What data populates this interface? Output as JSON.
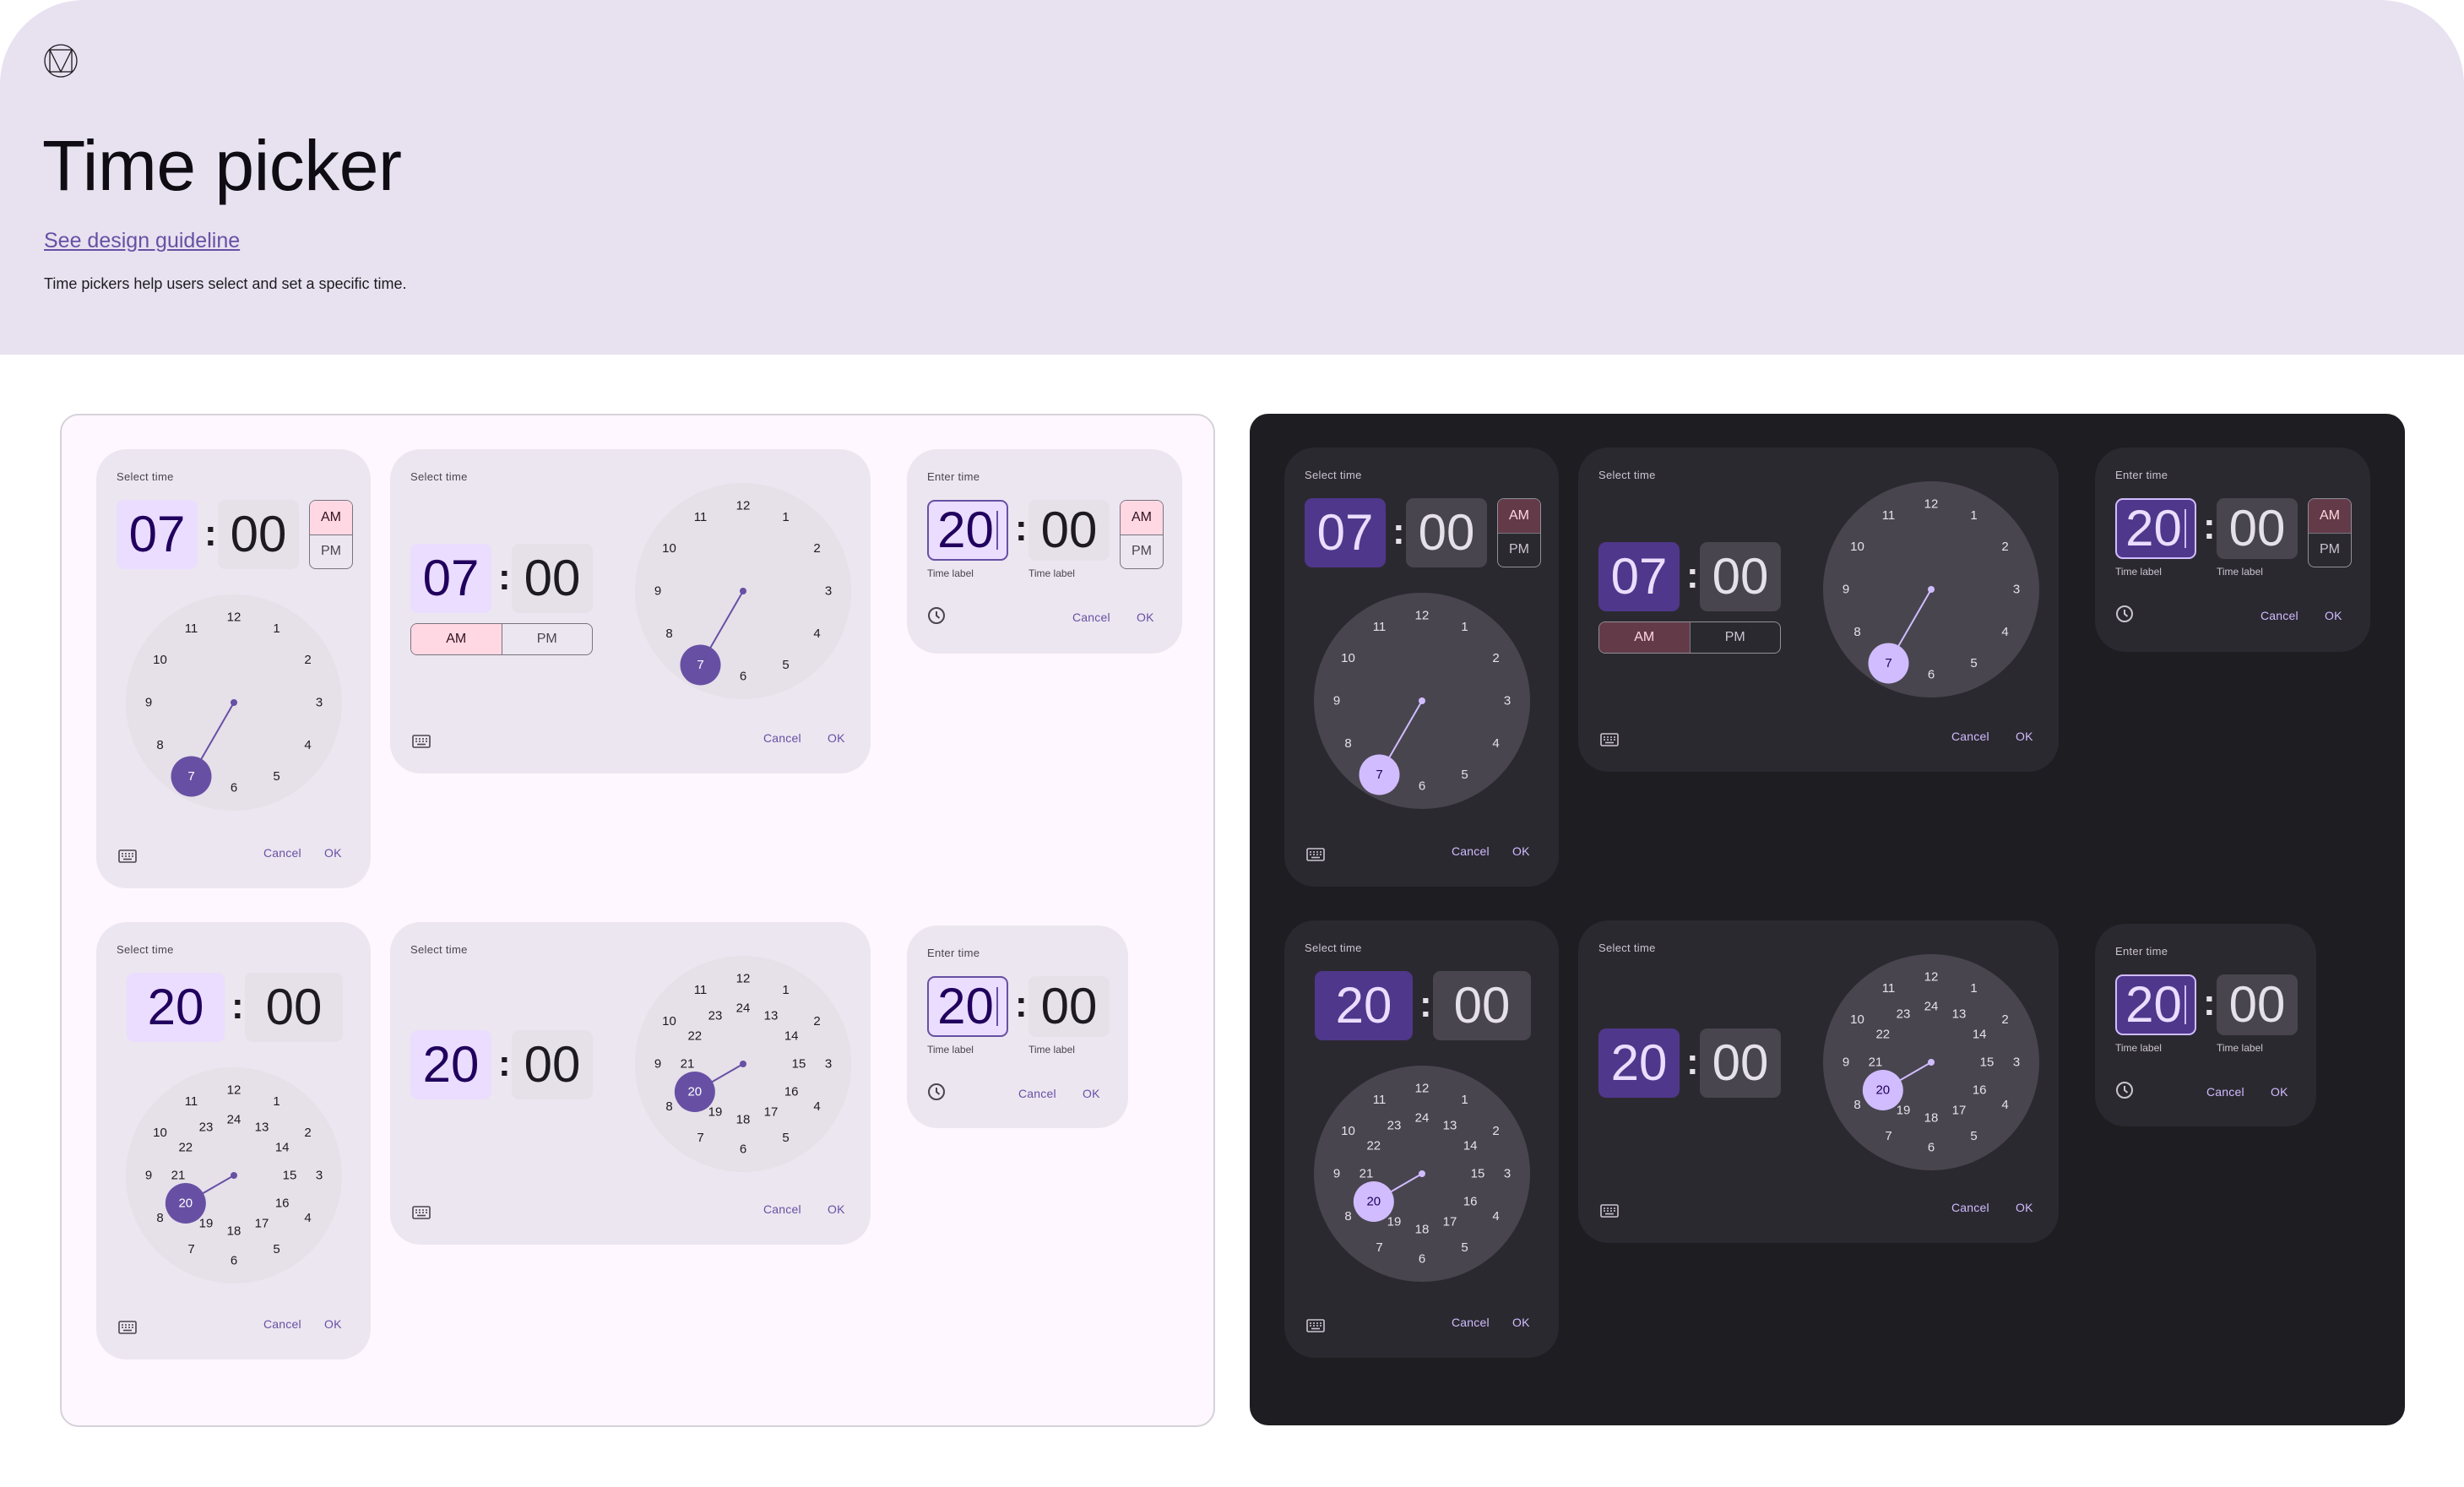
{
  "header": {
    "logo_icon": "material-logo-icon",
    "title": "Time picker",
    "link": "See design guideline",
    "description": "Time pickers help users select and set a specific time."
  },
  "colors": {
    "primary_light": "#6750A4",
    "primary_dark": "#D0BCFF",
    "header_bg": "#E8E2F0",
    "dark_panel_bg": "#1E1D21"
  },
  "labels": {
    "select_time": "Select time",
    "enter_time": "Enter time",
    "am": "AM",
    "pm": "PM",
    "cancel": "Cancel",
    "ok": "OK",
    "time_label": "Time label",
    "colon": ":"
  },
  "dial_12": [
    "12",
    "1",
    "2",
    "3",
    "4",
    "5",
    "6",
    "7",
    "8",
    "9",
    "10",
    "11"
  ],
  "dial_24_inner": [
    "24",
    "13",
    "14",
    "15",
    "16",
    "17",
    "18",
    "19",
    "20",
    "21",
    "22",
    "23"
  ],
  "themes": [
    {
      "name": "light",
      "pickers": [
        {
          "id": "dial-vertical-12h",
          "type": "dial-vertical",
          "hour": "07",
          "minute": "00",
          "period": "AM",
          "format": "12h",
          "selected_hour": 7
        },
        {
          "id": "dial-horizontal-12h",
          "type": "dial-horizontal",
          "hour": "07",
          "minute": "00",
          "period": "AM",
          "format": "12h",
          "selected_hour": 7
        },
        {
          "id": "input-12h",
          "type": "input",
          "hour": "20",
          "minute": "00",
          "period": "AM",
          "format": "12h"
        },
        {
          "id": "dial-vertical-24h",
          "type": "dial-vertical",
          "hour": "20",
          "minute": "00",
          "format": "24h",
          "selected_hour": 20
        },
        {
          "id": "dial-horizontal-24h",
          "type": "dial-horizontal",
          "hour": "20",
          "minute": "00",
          "format": "24h",
          "selected_hour": 20
        },
        {
          "id": "input-24h",
          "type": "input",
          "hour": "20",
          "minute": "00",
          "format": "24h"
        }
      ]
    },
    {
      "name": "dark",
      "pickers": [
        {
          "id": "dial-vertical-12h",
          "type": "dial-vertical",
          "hour": "07",
          "minute": "00",
          "period": "AM",
          "format": "12h",
          "selected_hour": 7
        },
        {
          "id": "dial-horizontal-12h",
          "type": "dial-horizontal",
          "hour": "07",
          "minute": "00",
          "period": "AM",
          "format": "12h",
          "selected_hour": 7
        },
        {
          "id": "input-12h",
          "type": "input",
          "hour": "20",
          "minute": "00",
          "period": "AM",
          "format": "12h"
        },
        {
          "id": "dial-vertical-24h",
          "type": "dial-vertical",
          "hour": "20",
          "minute": "00",
          "format": "24h",
          "selected_hour": 20
        },
        {
          "id": "dial-horizontal-24h",
          "type": "dial-horizontal",
          "hour": "20",
          "minute": "00",
          "format": "24h",
          "selected_hour": 20
        },
        {
          "id": "input-24h",
          "type": "input",
          "hour": "20",
          "minute": "00",
          "format": "24h"
        }
      ]
    }
  ]
}
